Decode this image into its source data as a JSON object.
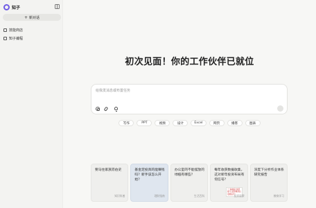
{
  "app": {
    "name": "知子"
  },
  "sidebar": {
    "new_chat_label": "新对话",
    "items": [
      {
        "label": "技能商店",
        "icon": "store-icon"
      },
      {
        "label": "知子编程",
        "icon": "code-icon"
      }
    ]
  },
  "main": {
    "headline": "初次见面！你的工作伙伴已就位",
    "input": {
      "placeholder": "给我发消息或布置任务"
    },
    "chips": [
      "写作",
      "PPT",
      "视频",
      "设计",
      "Excel",
      "网页",
      "播客",
      "图表"
    ],
    "cards": [
      {
        "text": "要马住家族昂伯史",
        "meta": "知识科普"
      },
      {
        "text": "基金定投真的能赚钱吗？新手该怎么开始？",
        "meta": "理财指南"
      },
      {
        "text": "办公室的不能摆放的绿植有哪些？",
        "meta": "生活百科"
      },
      {
        "text": "每年收获数据收集，这对新年投资布局有何信号？",
        "meta": "投资观察",
        "thumb_text": "\"一种收获\"的回报\"让这里收获后更能说不\""
      },
      {
        "text": "深度下分析作业体系研究报告",
        "meta": "教育学习"
      }
    ]
  },
  "colors": {
    "brand": "#6e5ae6",
    "active_card": "#dfe6ef"
  }
}
